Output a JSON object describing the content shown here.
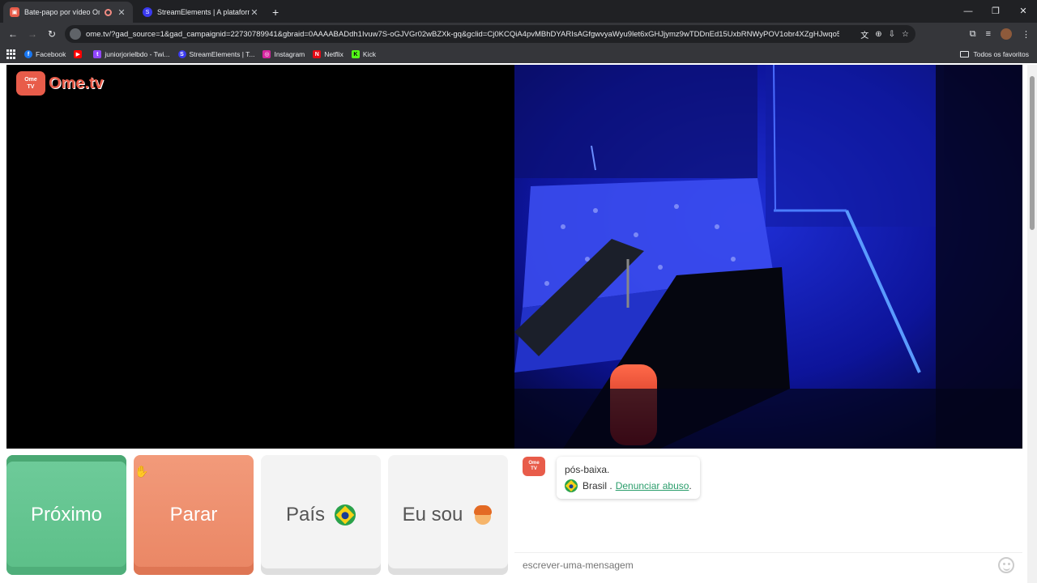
{
  "browser": {
    "tabs": [
      {
        "title": "Bate-papo por vídeo Ome.TV",
        "active": true
      },
      {
        "title": "StreamElements | A plataforma",
        "active": false
      }
    ],
    "url": "ome.tv/?gad_source=1&gad_campaignid=22730789941&gbraid=0AAAABADdh1Ivuw7S-oGJVGr02wBZXk-gq&gclid=Cj0KCQiA4pvMBhDYARIsAGfgwvyaWyu9let6xGHJjymz9wTDDnEd15UxbRNWyPOV1obr4XZgHJwqo5caAun...",
    "bookmarks": [
      {
        "label": "Facebook",
        "color": "#1877f2",
        "glyph": "f"
      },
      {
        "label": "",
        "color": "#ff0000",
        "glyph": "▶"
      },
      {
        "label": "juniorjorielbdo - Twi...",
        "color": "#9146ff",
        "glyph": "t"
      },
      {
        "label": "StreamElements | T...",
        "color": "#3a3af0",
        "glyph": "S"
      },
      {
        "label": "Instagram",
        "color": "#d6249f",
        "glyph": "◎"
      },
      {
        "label": "Netflix",
        "color": "#e50914",
        "glyph": "N"
      },
      {
        "label": "Kick",
        "color": "#53fc18",
        "glyph": "K"
      }
    ],
    "all_bookmarks_label": "Todos os favoritos"
  },
  "site": {
    "logo_text": "Ome.tv",
    "logo_badge_top": "Ome",
    "logo_badge_bottom": "TV"
  },
  "controls": {
    "next_label": "Próximo",
    "stop_label": "Parar",
    "country_label": "País",
    "iam_label": "Eu sou"
  },
  "chat": {
    "message_text": "pós-baixa.",
    "country": "Brasil .",
    "report_link": "Denunciar abuso",
    "report_suffix": ".",
    "input_placeholder": "escrever-uma-mensagem"
  },
  "colors": {
    "next": "#5cbf88",
    "stop": "#ea8664",
    "brand": "#e85c4a",
    "link": "#2a9d6b"
  }
}
